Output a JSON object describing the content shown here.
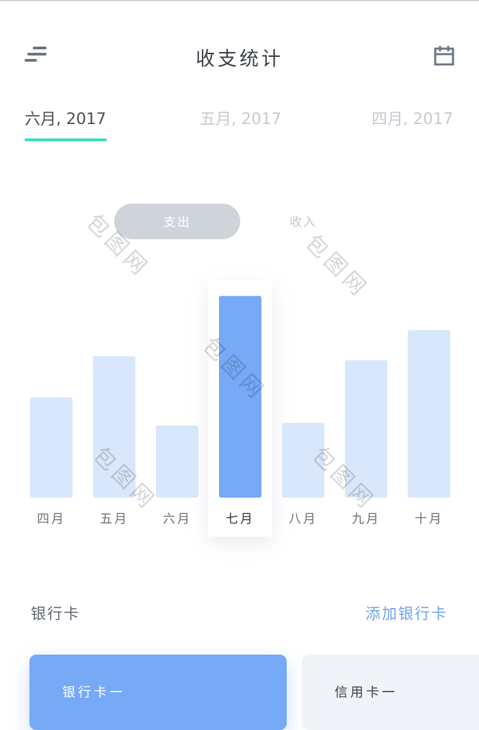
{
  "header": {
    "title": "收支统计",
    "menu_icon": "menu-icon",
    "calendar_icon": "calendar-icon"
  },
  "month_tabs": [
    {
      "label": "六月, 2017",
      "active": true
    },
    {
      "label": "五月, 2017",
      "active": false
    },
    {
      "label": "四月, 2017",
      "active": false
    }
  ],
  "toggle": {
    "expense_label": "支出",
    "income_label": "收入",
    "selected": "expense"
  },
  "chart_data": {
    "type": "bar",
    "categories": [
      "四月",
      "五月",
      "六月",
      "七月",
      "八月",
      "九月",
      "十月"
    ],
    "values": [
      150,
      212,
      108,
      302,
      112,
      206,
      251
    ],
    "highlighted": "七月",
    "ylim": [
      0,
      310
    ],
    "grid": false,
    "colors": {
      "bar": "#d9e7fc",
      "highlight": "#76a9f6"
    }
  },
  "bank_section": {
    "title": "银行卡",
    "add_label": "添加银行卡",
    "cards": [
      {
        "label": "银行卡一",
        "color": "#76a9f6"
      },
      {
        "label": "信用卡一",
        "color": "#f0f3f7"
      }
    ]
  },
  "colors": {
    "accent_tab": "#36dcbf",
    "link": "#6fa2ec"
  },
  "watermark": "包图网"
}
